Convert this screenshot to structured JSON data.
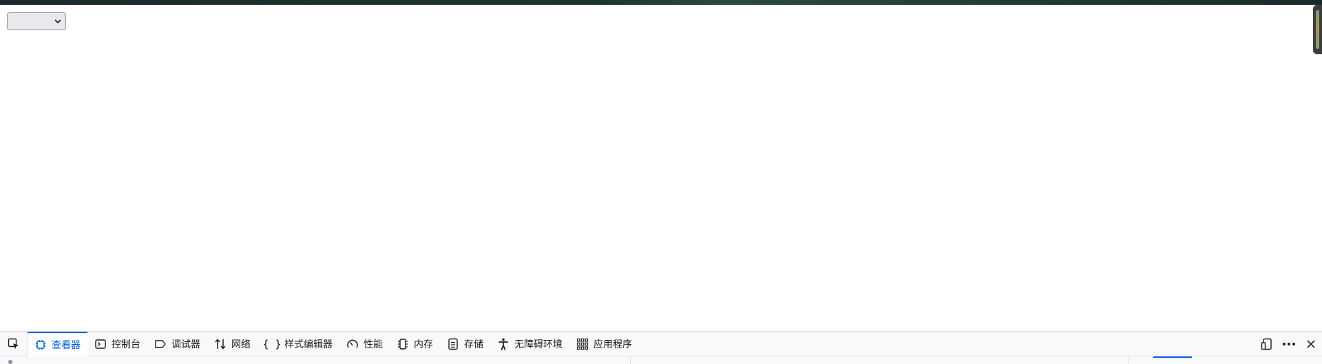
{
  "page": {
    "select_value": ""
  },
  "devtools": {
    "tabs": [
      {
        "id": "inspector",
        "label": "查看器",
        "icon": "inspector-icon",
        "selected": true
      },
      {
        "id": "console",
        "label": "控制台",
        "icon": "console-icon",
        "selected": false
      },
      {
        "id": "debugger",
        "label": "调试器",
        "icon": "debugger-icon",
        "selected": false
      },
      {
        "id": "network",
        "label": "网络",
        "icon": "network-icon",
        "selected": false
      },
      {
        "id": "style-editor",
        "label": "样式编辑器",
        "icon": "style-editor-icon",
        "selected": false
      },
      {
        "id": "performance",
        "label": "性能",
        "icon": "performance-icon",
        "selected": false
      },
      {
        "id": "memory",
        "label": "内存",
        "icon": "memory-icon",
        "selected": false
      },
      {
        "id": "storage",
        "label": "存储",
        "icon": "storage-icon",
        "selected": false
      },
      {
        "id": "accessibility",
        "label": "无障碍环境",
        "icon": "accessibility-icon",
        "selected": false
      },
      {
        "id": "application",
        "label": "应用程序",
        "icon": "application-icon",
        "selected": false
      }
    ],
    "accent_color": "#0061e0"
  }
}
